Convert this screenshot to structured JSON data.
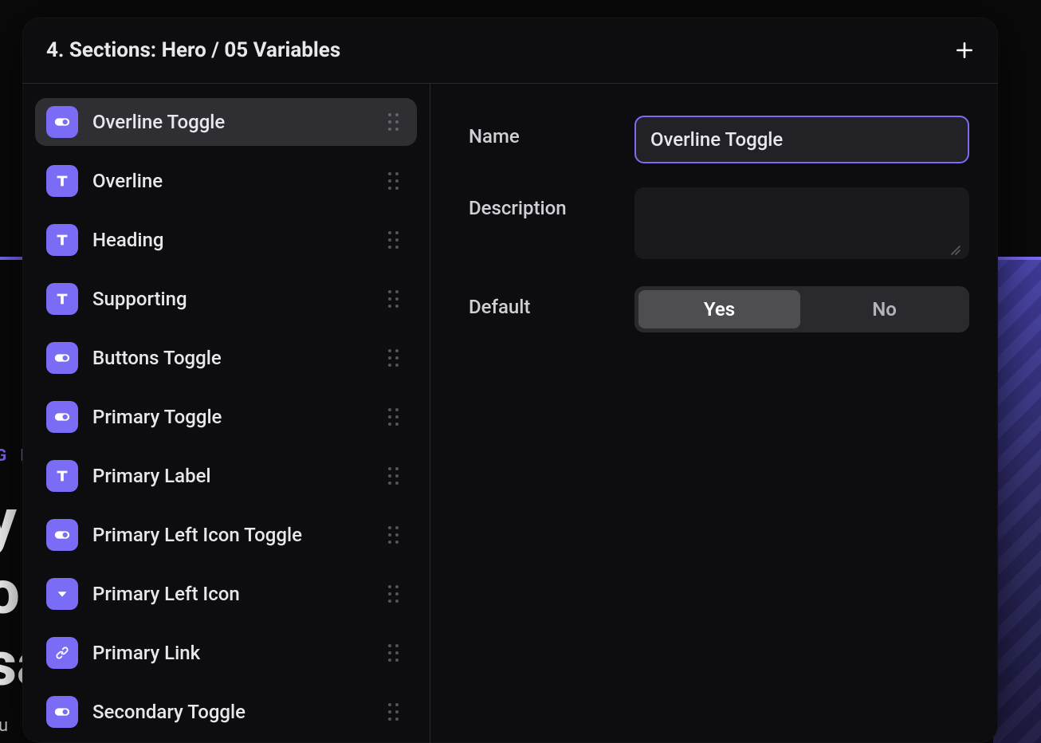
{
  "colors": {
    "accent": "#7b6cf6"
  },
  "background": {
    "overline": "G R",
    "line1": "y",
    "line2": "o",
    "line3": "sa",
    "sub": "u"
  },
  "panel": {
    "title": "4. Sections: Hero / 05 Variables"
  },
  "variables": [
    {
      "label": "Overline Toggle",
      "icon": "toggle",
      "active": true
    },
    {
      "label": "Overline",
      "icon": "text",
      "active": false
    },
    {
      "label": "Heading",
      "icon": "text",
      "active": false
    },
    {
      "label": "Supporting",
      "icon": "text",
      "active": false
    },
    {
      "label": "Buttons Toggle",
      "icon": "toggle",
      "active": false
    },
    {
      "label": "Primary Toggle",
      "icon": "toggle",
      "active": false
    },
    {
      "label": "Primary Label",
      "icon": "text",
      "active": false
    },
    {
      "label": "Primary Left Icon Toggle",
      "icon": "toggle",
      "active": false
    },
    {
      "label": "Primary Left Icon",
      "icon": "dropdown",
      "active": false
    },
    {
      "label": "Primary Link",
      "icon": "link",
      "active": false
    },
    {
      "label": "Secondary Toggle",
      "icon": "toggle",
      "active": false
    }
  ],
  "form": {
    "nameLabel": "Name",
    "nameValue": "Overline Toggle",
    "descLabel": "Description",
    "descValue": "",
    "defaultLabel": "Default",
    "options": {
      "yes": "Yes",
      "no": "No"
    },
    "selected": "yes"
  }
}
